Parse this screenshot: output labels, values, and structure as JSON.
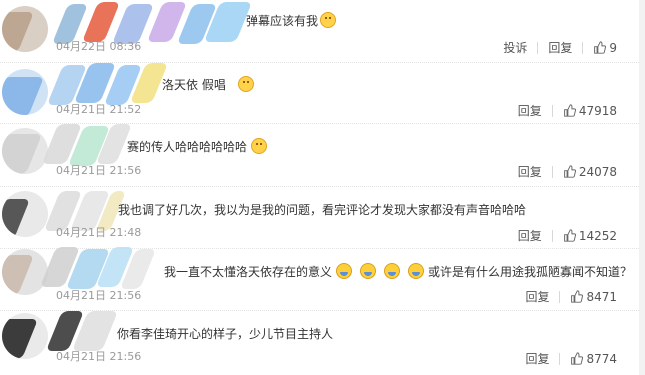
{
  "comments": [
    {
      "text": "弹幕应该有我",
      "emoji_after": true,
      "time": "04月22日 08:36",
      "report_label": "投诉",
      "reply_label": "回复",
      "likes": "9"
    },
    {
      "text": "洛天依 假唱",
      "emoji_after": true,
      "time": "04月21日 21:52",
      "reply_label": "回复",
      "likes": "47918"
    },
    {
      "text": "赛的传人哈哈哈哈哈哈",
      "emoji_after": true,
      "time": "04月21日 21:56",
      "reply_label": "回复",
      "likes": "24078"
    },
    {
      "text": "我也调了好几次，我以为是我的问题，看完评论才发现大家都没有声音哈哈哈",
      "time": "04月21日 21:48",
      "reply_label": "回复",
      "likes": "14252"
    },
    {
      "text_before": "我一直不太懂洛天依存在的意义",
      "text_after": "或许是有什么用途我孤陋寡闻不知道？",
      "time": "04月21日 21:56",
      "reply_label": "回复",
      "likes": "8471"
    },
    {
      "text": "你看李佳琦开心的样子，少儿节目主持人",
      "time": "04月21日 21:56",
      "reply_label": "回复",
      "likes": "8774"
    }
  ],
  "icons": {
    "like": "thumbs-up-icon",
    "emoji": "doge-face-icon",
    "laugh": "laughing-tears-icon"
  }
}
